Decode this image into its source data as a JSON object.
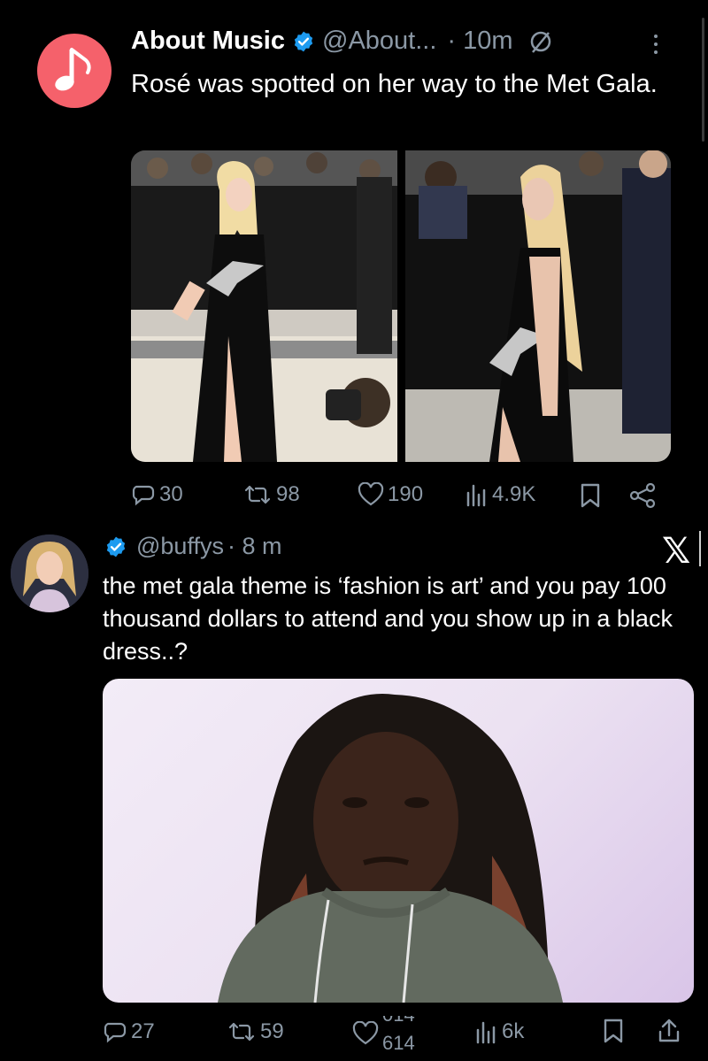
{
  "tweet1": {
    "author_name": "About Music",
    "handle": "@About...",
    "time": "· 10m",
    "text": "Rosé was spotted on her way to the Met Gala.",
    "stats": {
      "replies": "30",
      "reposts": "98",
      "likes": "190",
      "views": "4.9K"
    }
  },
  "tweet2": {
    "handle": "@buffys",
    "time": "· 8 m",
    "text": "the met gala theme is ‘fashion is art’ and you pay 100 thousand dollars to attend and you show up in a black dress..?",
    "stats": {
      "replies": "27",
      "reposts": "59",
      "likes_top": "014",
      "likes": "614",
      "views": "6k"
    }
  },
  "colors": {
    "background": "#000000",
    "text": "#e7e9ea",
    "muted": "#8b98a5",
    "verified": "#1d9bf0",
    "music_avatar": "#f5616b"
  },
  "icons": [
    "music-note-icon",
    "verified-badge-icon",
    "mute-icon",
    "more-icon",
    "reply-icon",
    "repost-icon",
    "like-icon",
    "views-icon",
    "bookmark-icon",
    "share-icon",
    "x-logo-icon"
  ]
}
